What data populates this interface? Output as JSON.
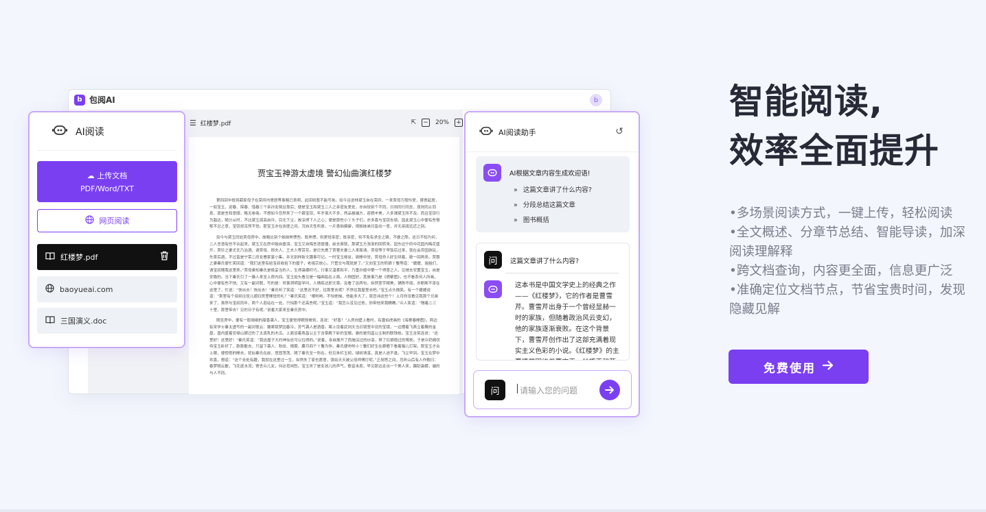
{
  "app": {
    "name": "包阅AI",
    "logo_letter": "b",
    "avatar_letter": "b"
  },
  "pdf": {
    "filename": "红楼梦.pdf",
    "zoom": "20%",
    "title": "贾宝玉神游太虚境 警幻仙曲演红楼梦",
    "paragraphs": [
      "第四回中既将薛家母子在荣府内寄居等事略已表明，此回则暂不能写矣。如今且说林黛玉自在荣府，一来贾母万般怜爱，寝食起居，一如宝玉，迎春、探春、惜春三个亲孙女倒且靠后；便是宝玉和黛玉二人之亲密友爱处，亦自较别个不同，日则同行同坐，夜则同止同息，真是言和意顺，略无参商。不想如今忽然来了一个薛宝钗，年岁虽大不多，然品格端方，容貌丰美，人多谓黛玉所不及。而且宝钗行为豁达，随分从时，不比黛玉孤高自许，目无下尘，故深得下人之心；便是那些小丫头子们，亦多喜与宝钗去顽。因此黛玉心中便有些悒郁不忿之意，宝钗却浑然不觉。那宝玉亦在孩提之间，况自天性所禀，一片愚拙偏僻，视姊妹弟兄皆出一意，并无亲疏远近之别。",
      "如今与黛玉同处贾母房中，故略比别个姊妹熟惯些。既熟惯，则更觉亲密；既亲密，则不免有求全之毁，不虞之隙。这日不知为何，二人言语有些不合起来，黛玉又在房中独自垂泪，宝玉又自悔言语冒撞，前去俯就，那黛玉方渐渐的回转来。因东边宁府中花园内梅花盛开，贾珍之妻尤氏乃治酒，请贾母、邢夫人、王夫人等赏花。是日先携了贾蓉夫妻二人来面请。贾母等于早饭后过来，就在会芳园游玩，先茶后酒，不过皆是宁荣二府女眷家宴小集，并无别样新文趣事可记。一时宝玉倦怠，欲睡中觉，贾母命人好生哄着，歇一回再来。贾蓉之妻秦氏便忙笑回道：“我们这里有给宝叔收拾下的屋子，老祖宗放心，只管交与我就是了。”又向宝玉的奶娘丫鬟等道：“嬷嬷、姐姐们，请宝叔随我这里来。”贾母素知秦氏是极妥当的人，生得袅娜纤巧，行事又温柔和平，乃重孙媳中第一个得意之人，见她去安置宝玉，自是安稳的。当下秦氏引了一簇人来至上房内间。宝玉抬头看见是一幅画贴在上面，人物固好，其故事乃是《燃藜图》，也不看系何人所画，心中便有些不快。又有一副对联，写的是：世事洞明皆学问，人情练达即文章。及看了这两句，纵然室宇精美，铺陈华丽，亦断断不肯在这里了，忙说：“快出去！快出去！”秦氏听了笑道：“这里还不好，往那里去呢？不然往我屋里去吧。”宝玉点头微笑。有一个嬷嬷说道：“那里有个叔叔往侄儿媳妇房里睡觉的礼？”秦氏笑道：“嗳哟哟，不怕他恼，他能多大了，就忌讳这些个！上月你没看见我那个兄弟来了，虽然与宝叔同年，两个人若站在一处，只怕那个还高些呢。”宝玉道：“我怎么没见过他，你带他来我瞧瞧。”众人笑道：“隔着二三十里，那里带去？见的日子有呢。”说着大家来至秦氏房中。",
      "刚至房中，便有一股细细的甜香袭人，宝玉便觉得眼饧骨软，连说：“好香！”入房向壁上看时，有唐伯虎画的《海棠春睡图》，两边有宋学士秦太虚写的一副对联云：嫩寒锁梦因春冷，芳气袭人是酒香。案上设着武则天当日镜室中设的宝镜，一边摆着飞燕立着舞的金盘，盘内盛着安禄山掷过伤了太真乳的木瓜。上面设着寿昌公主于含章殿下卧的宝榻，悬的是同昌公主制的联珠帐。宝玉含笑连说：“这里好！这里好！”秦氏笑道：“我这屋子大约神仙也可以住得的。”说着，亲自展开了西施浣过的纱衾，移了红娘抱过的鸳枕。于是众奶姆伏侍宝玉卧好了，款款散去，只留下袭人、秋纹、晴雯、麝月四个丫鬟为伴。秦氏便吩咐小丫鬟们好生在廊檐下看着猫儿打架。那宝玉才合上眼，便惚惚的睡去，犹似秦氏在前，悠悠荡荡，随了秦氏至一所在。但见朱栏玉砌，绿树清溪，真是人迹不逢，飞尘罕到。宝玉在梦中欢喜，想道：“这个去处有趣，我就在这里过一生，纵然失了家也愿意，强如天天被父母师傅打呢。”正胡思之间，忽听山后有人作歌曰：春梦随云散，飞花逐水流；寄言众儿女，何必觅闲愁。宝玉听了是女孩儿的声气，歌音未息，早见那边走出一个美人来，蹁跹袅娜，端的与人不同。"
    ]
  },
  "sidebar": {
    "title": "AI阅读",
    "upload_label": "上传文档",
    "upload_formats": "PDF/Word/TXT",
    "web_read_label": "网页阅读",
    "files": [
      {
        "name": "红楼梦.pdf",
        "icon": "book-icon",
        "active": true
      },
      {
        "name": "baoyueai.com",
        "icon": "globe-icon",
        "active": false
      },
      {
        "name": "三国演义.doc",
        "icon": "book-icon",
        "active": false
      }
    ]
  },
  "chat": {
    "title": "AI阅读助手",
    "suggest_title": "AI根据文章内容生成欢迎语!",
    "suggestions": [
      "这篇文章讲了什么内容?",
      "分段总结这篇文章",
      "图书概括"
    ],
    "user_avatar_char": "问",
    "question": "这篇文章讲了什么内容?",
    "answer": "这本书是中国文学史上的经典之作——《红楼梦》，它的作者是曹雪芹。曹雪芹出身于一个曾经显赫一时的家族，但随着政治风云变幻，他的家族逐渐衰败。在这个背景下，曹雪芹创作出了这部充满着现实主义色彩的小说。《红楼梦》的主要情节围绕着贾宝玉、林黛玉和薛宝钗之间的爱情悲剧展开。",
    "input_placeholder": "请输入您的问题"
  },
  "hero": {
    "title_line1": "智能阅读,",
    "title_line2": "效率全面提升",
    "bullets": [
      "•多场景阅读方式，一键上传，轻松阅读",
      "•全文概述、分章节总结、智能导读，加深阅读理解释",
      "•跨文档查询，内容更全面，信息更广泛",
      "•准确定位文档节点，节省宝贵时间，发现隐藏见解"
    ],
    "cta_label": "免费使用"
  },
  "colors": {
    "accent": "#7b3ff2",
    "accent_border": "#c8a8f7",
    "background": "#f3f6fd",
    "active_item_bg": "#111111"
  }
}
